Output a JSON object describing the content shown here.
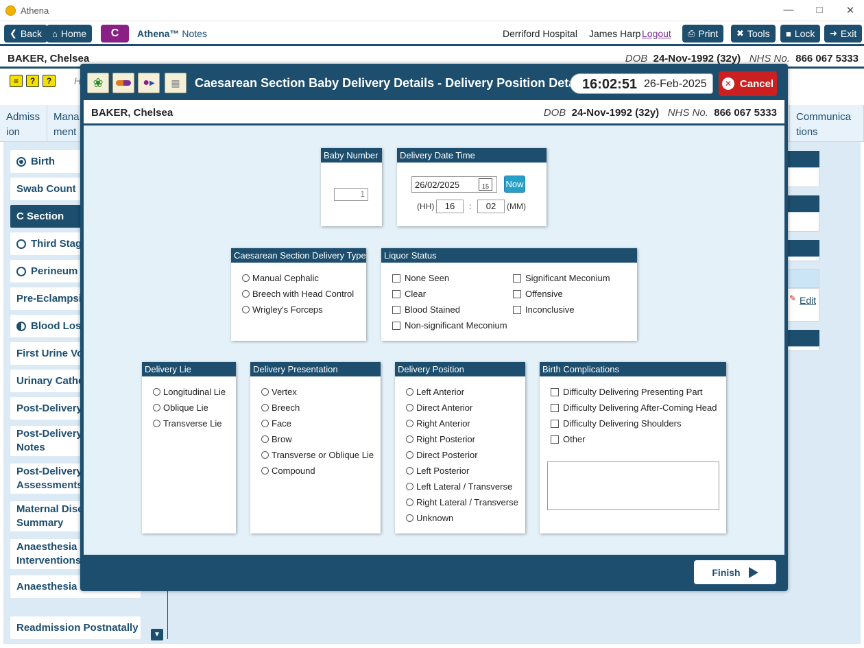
{
  "window": {
    "title": "Athena"
  },
  "nav": {
    "back": "Back",
    "home": "Home",
    "c_button": "C",
    "brand_name": "Athena™",
    "brand_suffix": "Notes",
    "hospital": "Derriford Hospital",
    "user": "James Harp",
    "logout": "Logout",
    "print": "Print",
    "tools": "Tools",
    "lock": "Lock",
    "exit": "Exit"
  },
  "patient": {
    "name": "BAKER, Chelsea",
    "dob_label": "DOB",
    "dob": "24-Nov-1992 (32y)",
    "nhs_label": "NHS No.",
    "nhs": "866 067 5333"
  },
  "background": {
    "partial_text": "H",
    "tabs": [
      {
        "label": "Admiss ion"
      },
      {
        "label": "Mana ment"
      },
      {
        "label": "Communica tions"
      }
    ],
    "sidebar": [
      {
        "label": "Birth",
        "status": "full"
      },
      {
        "label": "Swab Count",
        "status": "none"
      },
      {
        "label": "C Section",
        "status": "selected"
      },
      {
        "label": "Third Stage",
        "status": "empty"
      },
      {
        "label": "Perineum",
        "status": "empty"
      },
      {
        "label": "Pre-Eclampsia",
        "status": "none"
      },
      {
        "label": "Blood Loss",
        "status": "half"
      },
      {
        "label": "First Urine Voi",
        "status": "none"
      },
      {
        "label": "Urinary Cathe",
        "status": "none"
      },
      {
        "label": "Post-Delivery",
        "status": "none"
      },
      {
        "label": "Post-Delivery Notes",
        "status": "none"
      },
      {
        "label": "Post-Delivery Assessments",
        "status": "none"
      },
      {
        "label": "Maternal Disc Summary",
        "status": "none"
      },
      {
        "label": "Anaesthesia Interventions",
        "status": "none"
      },
      {
        "label": "Anaesthesia F",
        "status": "none"
      },
      {
        "label": "Readmission Postnatally",
        "status": "none"
      }
    ],
    "edit_link": "Edit"
  },
  "modal": {
    "title": "Caesarean Section Baby Delivery Details - Delivery Position Details",
    "time": "16:02:51",
    "date": "26-Feb-2025",
    "cancel": "Cancel",
    "finish": "Finish",
    "baby_number": {
      "header": "Baby Number",
      "value": "1"
    },
    "delivery_datetime": {
      "header": "Delivery Date Time",
      "date": "26/02/2025",
      "calendar_day": "15",
      "now": "Now",
      "hh_label": "(HH)",
      "hh": "16",
      "sep": ":",
      "mm": "02",
      "mm_label": "(MM)"
    },
    "cs_delivery_type": {
      "header": "Caesarean Section Delivery Type",
      "options": [
        "Manual Cephalic",
        "Breech with Head Control",
        "Wrigley's Forceps"
      ]
    },
    "liquor_status": {
      "header": "Liquor Status",
      "options": [
        "None Seen",
        "Significant Meconium",
        "Clear",
        "Offensive",
        "Blood Stained",
        "Inconclusive",
        "Non-significant Meconium"
      ]
    },
    "delivery_lie": {
      "header": "Delivery Lie",
      "options": [
        "Longitudinal Lie",
        "Oblique Lie",
        "Transverse Lie"
      ]
    },
    "delivery_presentation": {
      "header": "Delivery Presentation",
      "options": [
        "Vertex",
        "Breech",
        "Face",
        "Brow",
        "Transverse or Oblique Lie",
        "Compound"
      ]
    },
    "delivery_position": {
      "header": "Delivery Position",
      "options": [
        "Left Anterior",
        "Direct Anterior",
        "Right Anterior",
        "Right Posterior",
        "Direct Posterior",
        "Left Posterior",
        "Left Lateral / Transverse",
        "Right Lateral / Transverse",
        "Unknown"
      ]
    },
    "birth_complications": {
      "header": "Birth Complications",
      "options": [
        "Difficulty Delivering Presenting Part",
        "Difficulty Delivering After-Coming Head",
        "Difficulty Delivering Shoulders",
        "Other"
      ],
      "notes": ""
    }
  }
}
